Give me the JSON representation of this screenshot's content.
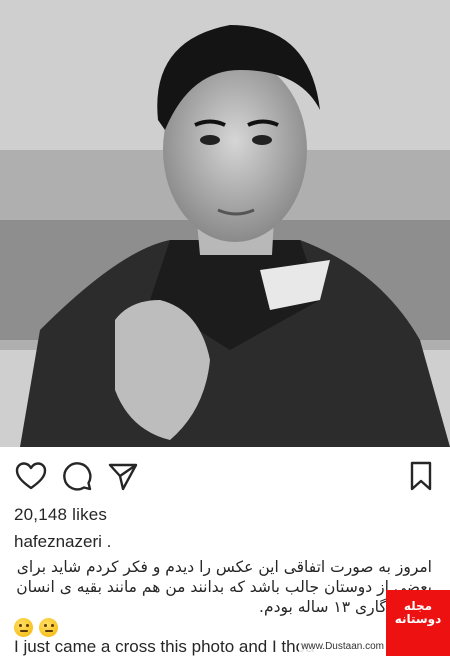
{
  "post": {
    "photo_alt": "",
    "likes": "20,148 likes",
    "username": "hafeznazeri .",
    "caption_fa": "امروز به صورت اتفاقی این عکس را دیدم و فکر کردم شاید برای بعضی از دوستان جالب باشد که بدانند من هم مانند بقیه ی انسان ها، روزگاری ۱۳ ساله بودم.",
    "caption_en": "I just came a cross this photo and I thou"
  },
  "actions": {
    "icons": [
      "heart-icon",
      "comment-icon",
      "share-icon",
      "bookmark-icon"
    ]
  },
  "watermark": {
    "brand": "مجله دوستانه",
    "sub": "",
    "site": "www.Dustaan.com"
  },
  "colors": {
    "text": "#262626",
    "watermark_bg": "#ee1111"
  }
}
